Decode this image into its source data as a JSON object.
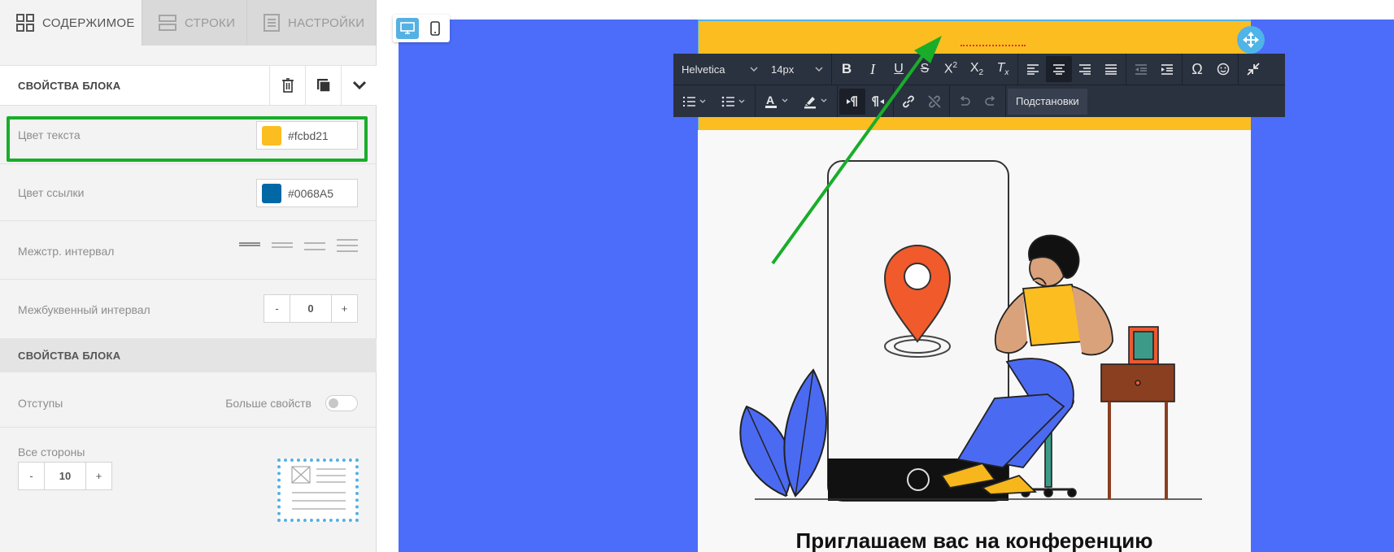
{
  "tabs": [
    {
      "label": "СОДЕРЖИМОЕ",
      "icon": "grid-icon",
      "active": true
    },
    {
      "label": "СТРОКИ",
      "icon": "rows-icon",
      "active": false
    },
    {
      "label": "НАСТРОЙКИ",
      "icon": "settings-doc-icon",
      "active": false
    }
  ],
  "block_props": {
    "title": "СВОЙСТВА БЛОКА",
    "text_color_label": "Цвет текста",
    "text_color_value": "#fcbd21",
    "link_color_label": "Цвет ссылки",
    "link_color_value": "#0068A5",
    "line_height_label": "Межстр. интервал",
    "letter_spacing_label": "Межбуквенный интервал",
    "letter_spacing": {
      "minus": "-",
      "value": "0",
      "plus": "+"
    }
  },
  "block_section": {
    "title": "СВОЙСТВА БЛОКА",
    "padding_label": "Отступы",
    "more_props_label": "Больше свойств",
    "all_sides_label": "Все стороны",
    "all_sides": {
      "minus": "-",
      "value": "10",
      "plus": "+"
    }
  },
  "toolbar": {
    "font_family": "Helvetica",
    "font_size": "14px",
    "substitutions_label": "Подстановки"
  },
  "email": {
    "heading": "Приглашаем вас на конференцию"
  },
  "colors": {
    "canvas_bg": "#4c6cfa",
    "accent_yellow": "#fcbd21",
    "link_blue": "#0068A5",
    "selection_blue": "#4fb4e8",
    "highlight_green": "#19ad2a"
  }
}
